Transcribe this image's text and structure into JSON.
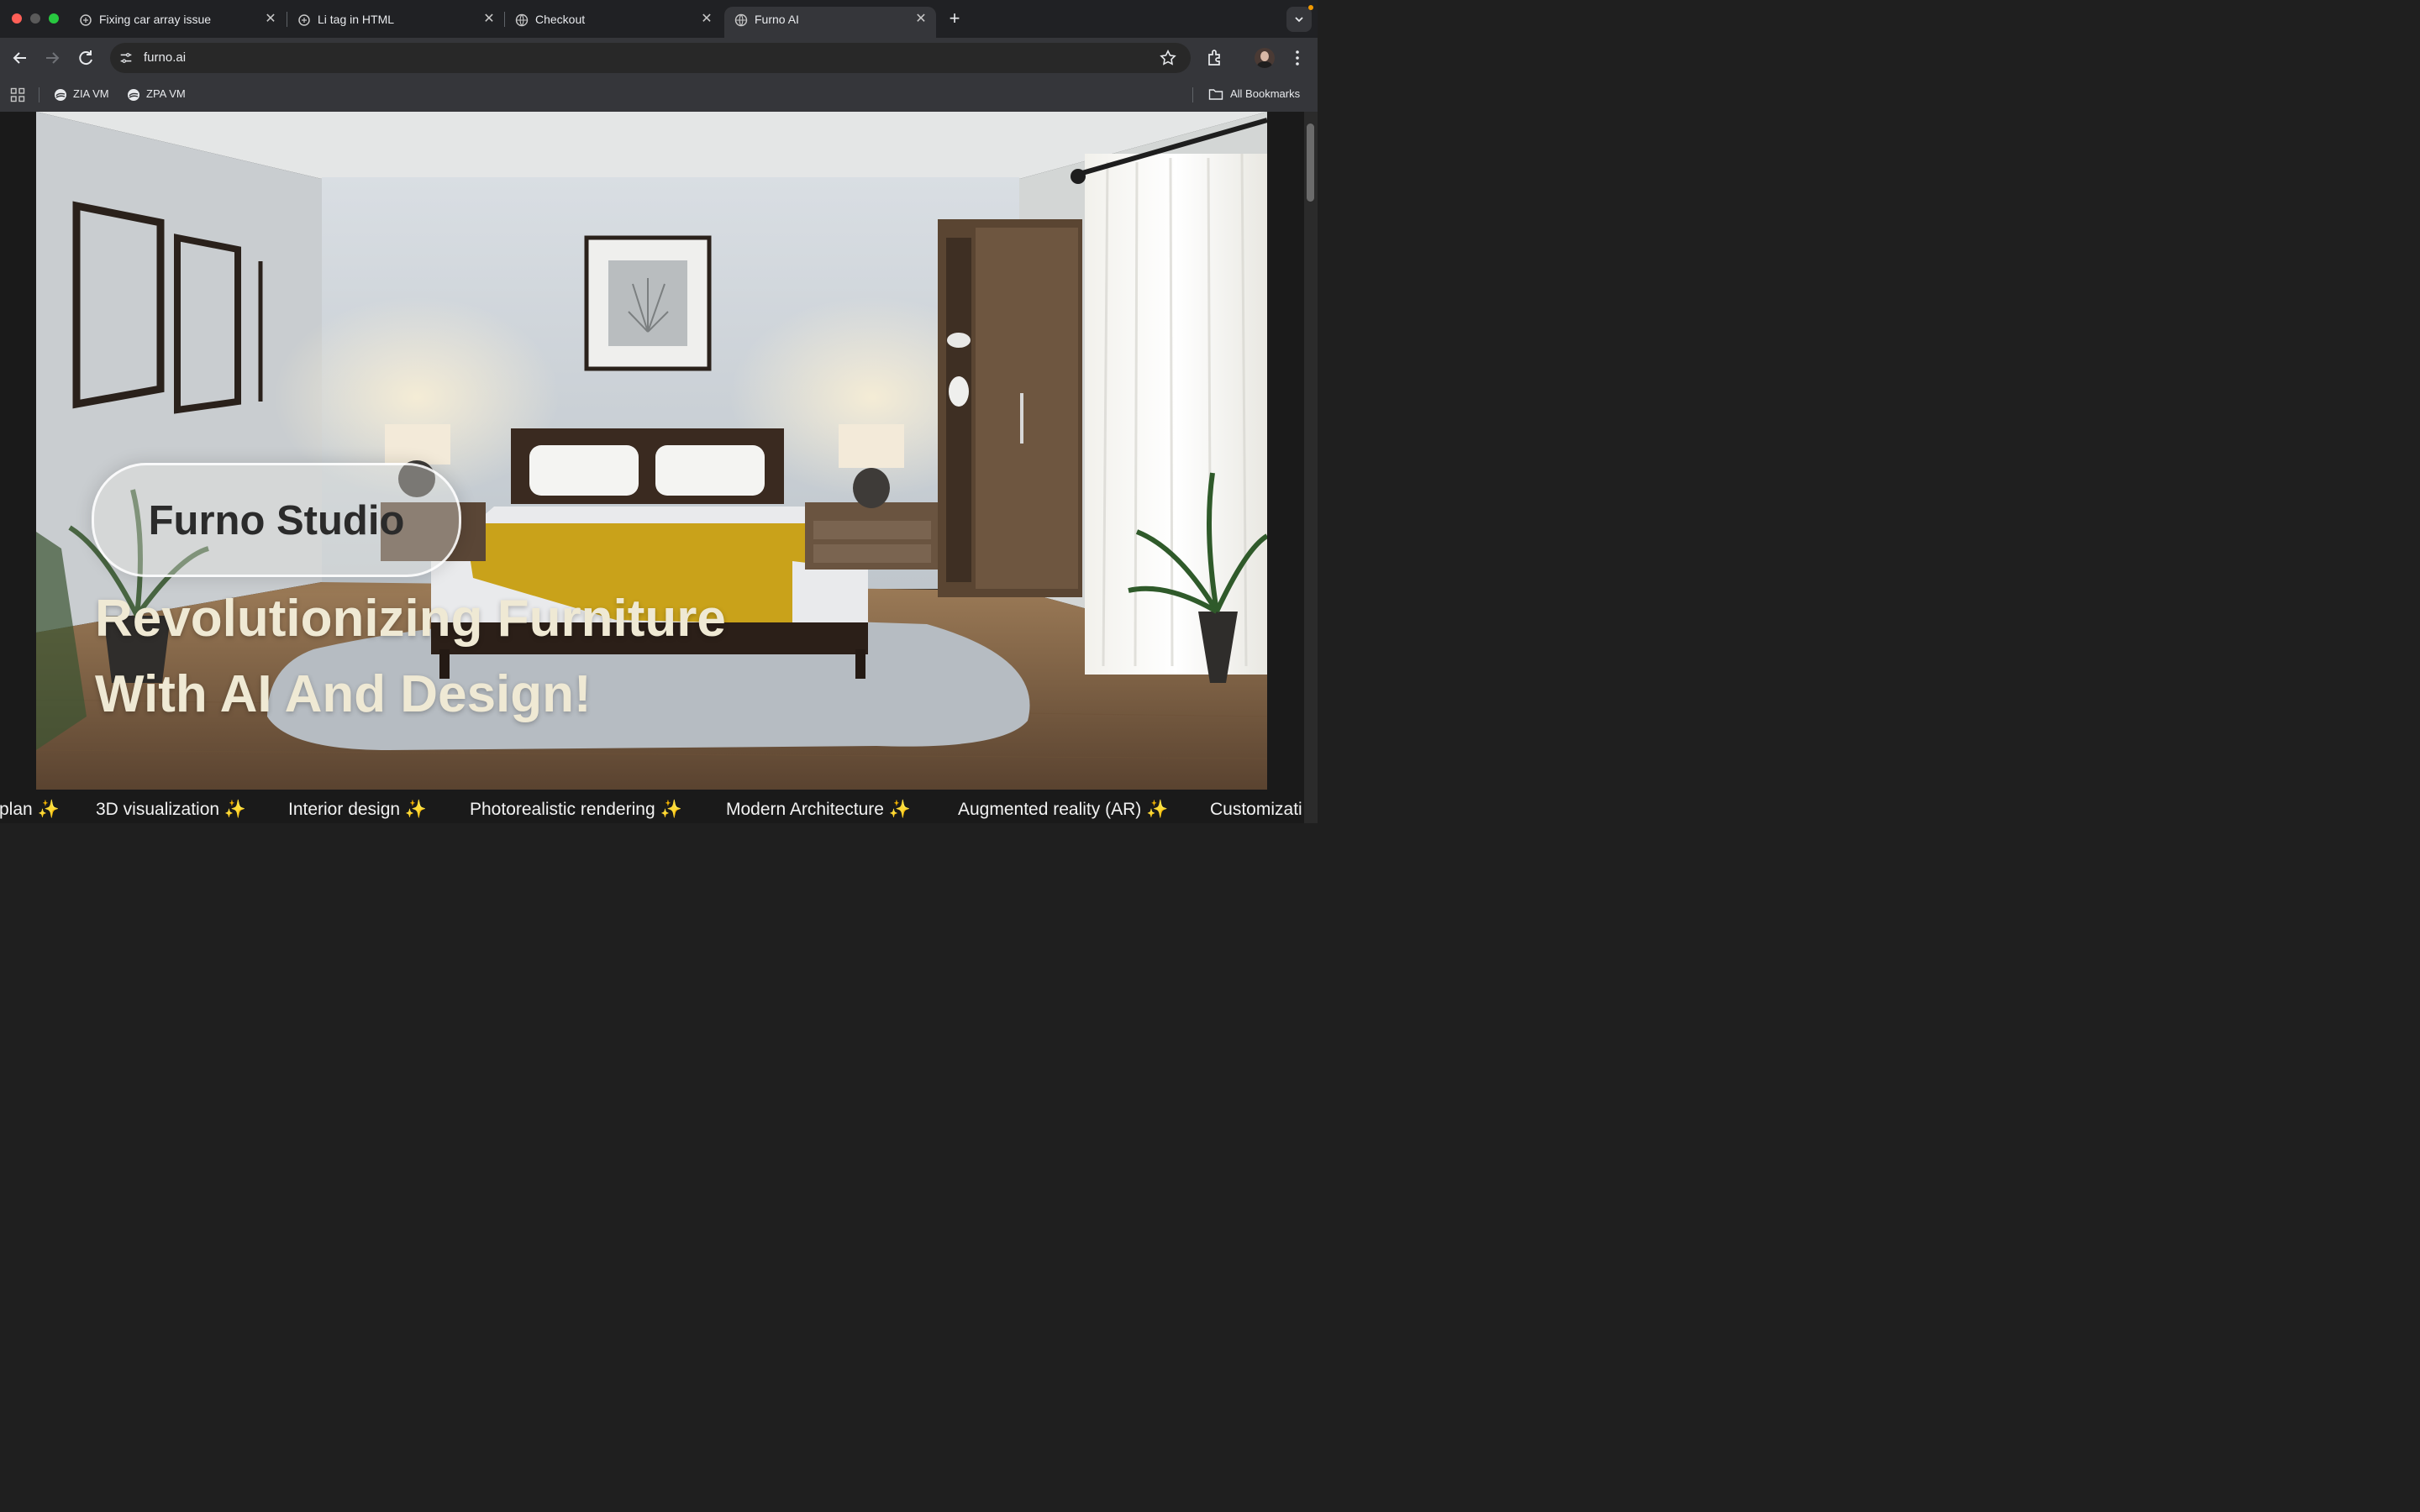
{
  "tabs": [
    {
      "title": "Fixing car array issue",
      "icon": "openai-icon"
    },
    {
      "title": "Li tag in HTML",
      "icon": "openai-icon"
    },
    {
      "title": "Checkout",
      "icon": "globe-icon"
    },
    {
      "title": "Furno AI",
      "icon": "globe-icon",
      "active": true
    }
  ],
  "address_bar": {
    "url": "furno.ai"
  },
  "bookmarks": [
    {
      "label": "ZIA VM"
    },
    {
      "label": "ZPA VM"
    }
  ],
  "all_bookmarks_label": "All Bookmarks",
  "hero": {
    "badge": "Furno Studio",
    "headline_line1": "Revolutionizing Furniture",
    "headline_line2": "With AI And Design!"
  },
  "ticker": [
    "plan ✨",
    "3D visualization ✨",
    "Interior design ✨",
    "Photorealistic rendering ✨",
    "Modern Architecture ✨",
    "Augmented reality (AR) ✨",
    "Customizati"
  ],
  "colors": {
    "headline": "#efe9d4",
    "throw_blanket": "#c9a21a"
  }
}
